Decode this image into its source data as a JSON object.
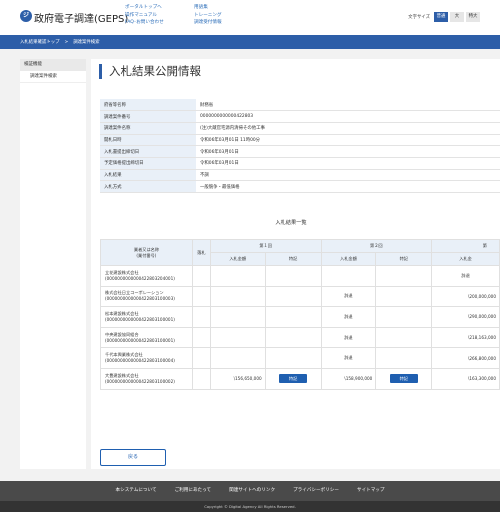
{
  "header": {
    "logo_mark": "ジ",
    "logo_text": "政府電子調達(GEPS)",
    "nav_col1": [
      "ポータルトップへ",
      "操作マニュアル",
      "FAQ･お問い合わせ"
    ],
    "nav_col2": [
      "用語集",
      "トレーニング",
      "調達受付情報"
    ],
    "font_size_label": "文字サイズ",
    "font_sizes": [
      "普通",
      "大",
      "特大"
    ],
    "font_size_active": "普通"
  },
  "breadcrumb": [
    "入札結果確認トップ",
    ">",
    "調達案件検索"
  ],
  "sidebar": {
    "head": "検証機能",
    "items": [
      "調達案件検索"
    ]
  },
  "main": {
    "title": "入札結果公開情報",
    "info": [
      {
        "k": "府省等名称",
        "v": "財務省"
      },
      {
        "k": "調達案件番号",
        "v": "0000000000000422803"
      },
      {
        "k": "調達案件名称",
        "v": "(注)大蔵官宅源内清掃その他工事"
      },
      {
        "k": "開札日時",
        "v": "令和06年03月01日 11時00分"
      },
      {
        "k": "入札書提出締切日",
        "v": "令和06年03月01日"
      },
      {
        "k": "予定価格提出締切日",
        "v": "令和06年03月01日"
      },
      {
        "k": "入札結果",
        "v": "不調"
      },
      {
        "k": "入札方式",
        "v": "一般競争・最低価格"
      }
    ],
    "list_title": "入札結果一覧",
    "table": {
      "h_bidder": "業者又は名称",
      "h_bidder_sub": "(業付番号)",
      "h_status": "落札",
      "h_round1": "第１回",
      "h_round2": "第２回",
      "h_round3": "第",
      "h_amount": "入札金額",
      "h_detail": "特記",
      "h_amount3": "入札金",
      "detail_btn": "特記",
      "rows": [
        {
          "name": "立花建設株式会社",
          "code": "(0000000000000422803204001)",
          "r1_amt": "",
          "r1_btn": false,
          "r2_amt": "",
          "r2_btn": false,
          "r3": "辞退"
        },
        {
          "name": "株式会社日立コーポレーション",
          "code": "(0000000000000422803100003)",
          "r1_amt": "",
          "r1_btn": false,
          "r2_amt": "辞退",
          "r2_btn": false,
          "r3": "\\200,000,000"
        },
        {
          "name": "松本建設株式会社",
          "code": "(0000000000000422803100001)",
          "r1_amt": "",
          "r1_btn": false,
          "r2_amt": "辞退",
          "r2_btn": false,
          "r3": "\\290,000,000"
        },
        {
          "name": "中央建設協同組合",
          "code": "(0000000000000422803100001)",
          "r1_amt": "",
          "r1_btn": false,
          "r2_amt": "辞退",
          "r2_btn": false,
          "r3": "\\218,163,000"
        },
        {
          "name": "千代本興業株式会社",
          "code": "(0000000000000422803100004)",
          "r1_amt": "",
          "r1_btn": false,
          "r2_amt": "辞退",
          "r2_btn": false,
          "r3": "\\266,800,000"
        },
        {
          "name": "大豊建設株式会社",
          "code": "(0000000000000422803100002)",
          "r1_amt": "\\156,650,000",
          "r1_btn": true,
          "r2_amt": "\\158,900,000",
          "r2_btn": true,
          "r3": "\\163,300,000"
        }
      ]
    },
    "back_label": "戻る"
  },
  "footer": {
    "links": [
      "本システムについて",
      "ご利用にあたって",
      "関連サイトへのリンク",
      "プライバシーポリシー",
      "サイトマップ"
    ],
    "copyright": "Copyright © Digital Agency All Rights Reserved."
  }
}
